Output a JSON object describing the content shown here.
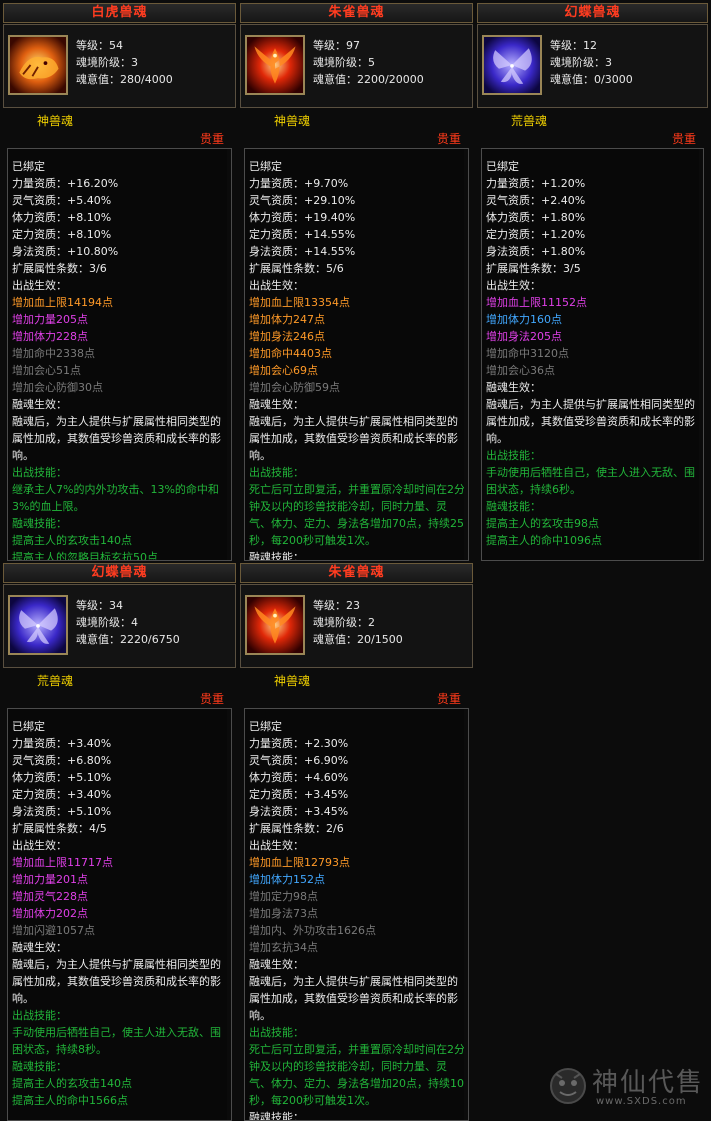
{
  "labels": {
    "level": "等级：",
    "stage": "魂境阶级：",
    "will": "魂意值：",
    "bound": "已绑定",
    "str_apt": "力量资质：",
    "spirit_apt": "灵气资质：",
    "phys_apt": "体力资质：",
    "focus_apt": "定力资质：",
    "agility_apt": "身法资质：",
    "ext_count": "扩展属性条数：",
    "battle_effect": "出战生效：",
    "fuse_effect": "融魂生效：",
    "fuse_desc": "融魂后，为主人提供与扩展属性相同类型的属性加成，其数值受珍兽资质和成长率的影响。",
    "battle_skill": "出战技能：",
    "fuse_skill": "融魂技能："
  },
  "colors": {
    "title": "#ff3c20",
    "type": "#f0d000",
    "rarity": "#ff3a1a",
    "orange": "#ff9a28",
    "purple": "#e040e8",
    "blue": "#42a8ff",
    "gray": "#7a7a7a",
    "green": "#22b63a"
  },
  "cards": [
    {
      "name": "白虎兽魂",
      "icon": "white-tiger-soul-icon",
      "level": "54",
      "stage": "3",
      "will": "280/4000",
      "type": "神兽魂",
      "rarity": "贵重",
      "str": "+16.20%",
      "spirit": "+5.40%",
      "phys": "+8.10%",
      "focus": "+8.10%",
      "agility": "+10.80%",
      "ext": "3/6",
      "battle_attrs": [
        {
          "text": "增加血上限14194点",
          "color": "orange"
        },
        {
          "text": "增加力量205点",
          "color": "purple"
        },
        {
          "text": "增加体力228点",
          "color": "purple"
        },
        {
          "text": "增加命中2338点",
          "color": "gray"
        },
        {
          "text": "增加会心51点",
          "color": "gray"
        },
        {
          "text": "增加会心防御30点",
          "color": "gray"
        }
      ],
      "battle_skill_text": "继承主人7%的内外功攻击、13%的命中和3%的血上限。",
      "fuse_skill_text": "提高主人的玄攻击140点",
      "fuse_skill_text2": "提高主人的忽略目标玄抗50点"
    },
    {
      "name": "朱雀兽魂",
      "icon": "vermilion-bird-soul-icon",
      "level": "97",
      "stage": "5",
      "will": "2200/20000",
      "type": "神兽魂",
      "rarity": "贵重",
      "str": "+9.70%",
      "spirit": "+29.10%",
      "phys": "+19.40%",
      "focus": "+14.55%",
      "agility": "+14.55%",
      "ext": "5/6",
      "battle_attrs": [
        {
          "text": "增加血上限13354点",
          "color": "orange"
        },
        {
          "text": "增加体力247点",
          "color": "orange"
        },
        {
          "text": "增加身法246点",
          "color": "orange"
        },
        {
          "text": "增加命中4403点",
          "color": "orange"
        },
        {
          "text": "增加会心69点",
          "color": "orange"
        },
        {
          "text": "增加会心防御59点",
          "color": "gray"
        }
      ],
      "battle_skill_text": "死亡后可立即复活，并重置原冷却时间在2分钟及以内的珍兽技能冷却，同时力量、灵气、体力、定力、身法各增加70点，持续25秒，每200秒可触发1次。",
      "fuse_skill_text": "",
      "fuse_skill_text2": ""
    },
    {
      "name": "幻蝶兽魂",
      "icon": "phantom-butterfly-soul-icon",
      "level": "12",
      "stage": "3",
      "will": "0/3000",
      "type": "荒兽魂",
      "rarity": "贵重",
      "str": "+1.20%",
      "spirit": "+2.40%",
      "phys": "+1.80%",
      "focus": "+1.20%",
      "agility": "+1.80%",
      "ext": "3/5",
      "battle_attrs": [
        {
          "text": "增加血上限11152点",
          "color": "purple"
        },
        {
          "text": "增加体力160点",
          "color": "blue"
        },
        {
          "text": "增加身法205点",
          "color": "purple"
        },
        {
          "text": "增加命中3120点",
          "color": "gray"
        },
        {
          "text": "增加会心36点",
          "color": "gray"
        }
      ],
      "battle_skill_text": "手动使用后牺牲自己，使主人进入无敌、围困状态，持续6秒。",
      "fuse_skill_text": "提高主人的玄攻击98点",
      "fuse_skill_text2": "提高主人的命中1096点"
    },
    {
      "name": "幻蝶兽魂",
      "icon": "phantom-butterfly-soul-icon",
      "level": "34",
      "stage": "4",
      "will": "2220/6750",
      "type": "荒兽魂",
      "rarity": "贵重",
      "str": "+3.40%",
      "spirit": "+6.80%",
      "phys": "+5.10%",
      "focus": "+3.40%",
      "agility": "+5.10%",
      "ext": "4/5",
      "battle_attrs": [
        {
          "text": "增加血上限11717点",
          "color": "purple"
        },
        {
          "text": "增加力量201点",
          "color": "purple"
        },
        {
          "text": "增加灵气228点",
          "color": "purple"
        },
        {
          "text": "增加体力202点",
          "color": "purple"
        },
        {
          "text": "增加闪避1057点",
          "color": "gray"
        }
      ],
      "battle_skill_text": "手动使用后牺牲自己，使主人进入无敌、围困状态，持续8秒。",
      "fuse_skill_text": "提高主人的玄攻击140点",
      "fuse_skill_text2": "提高主人的命中1566点"
    },
    {
      "name": "朱雀兽魂",
      "icon": "vermilion-bird-soul-icon",
      "level": "23",
      "stage": "2",
      "will": "20/1500",
      "type": "神兽魂",
      "rarity": "贵重",
      "str": "+2.30%",
      "spirit": "+6.90%",
      "phys": "+4.60%",
      "focus": "+3.45%",
      "agility": "+3.45%",
      "ext": "2/6",
      "battle_attrs": [
        {
          "text": "增加血上限12793点",
          "color": "orange"
        },
        {
          "text": "增加体力152点",
          "color": "blue"
        },
        {
          "text": "增加定力98点",
          "color": "gray"
        },
        {
          "text": "增加身法73点",
          "color": "gray"
        },
        {
          "text": "增加内、外功攻击1626点",
          "color": "gray"
        },
        {
          "text": "增加玄抗34点",
          "color": "gray"
        }
      ],
      "battle_skill_text": "死亡后可立即复活，并重置原冷却时间在2分钟及以内的珍兽技能冷却，同时力量、灵气、体力、定力、身法各增加20点，持续10秒，每200秒可触发1次。",
      "fuse_skill_text": "",
      "fuse_skill_text2": ""
    }
  ],
  "watermark": {
    "title": "神仙代售",
    "url": "www.SXDS.com"
  }
}
